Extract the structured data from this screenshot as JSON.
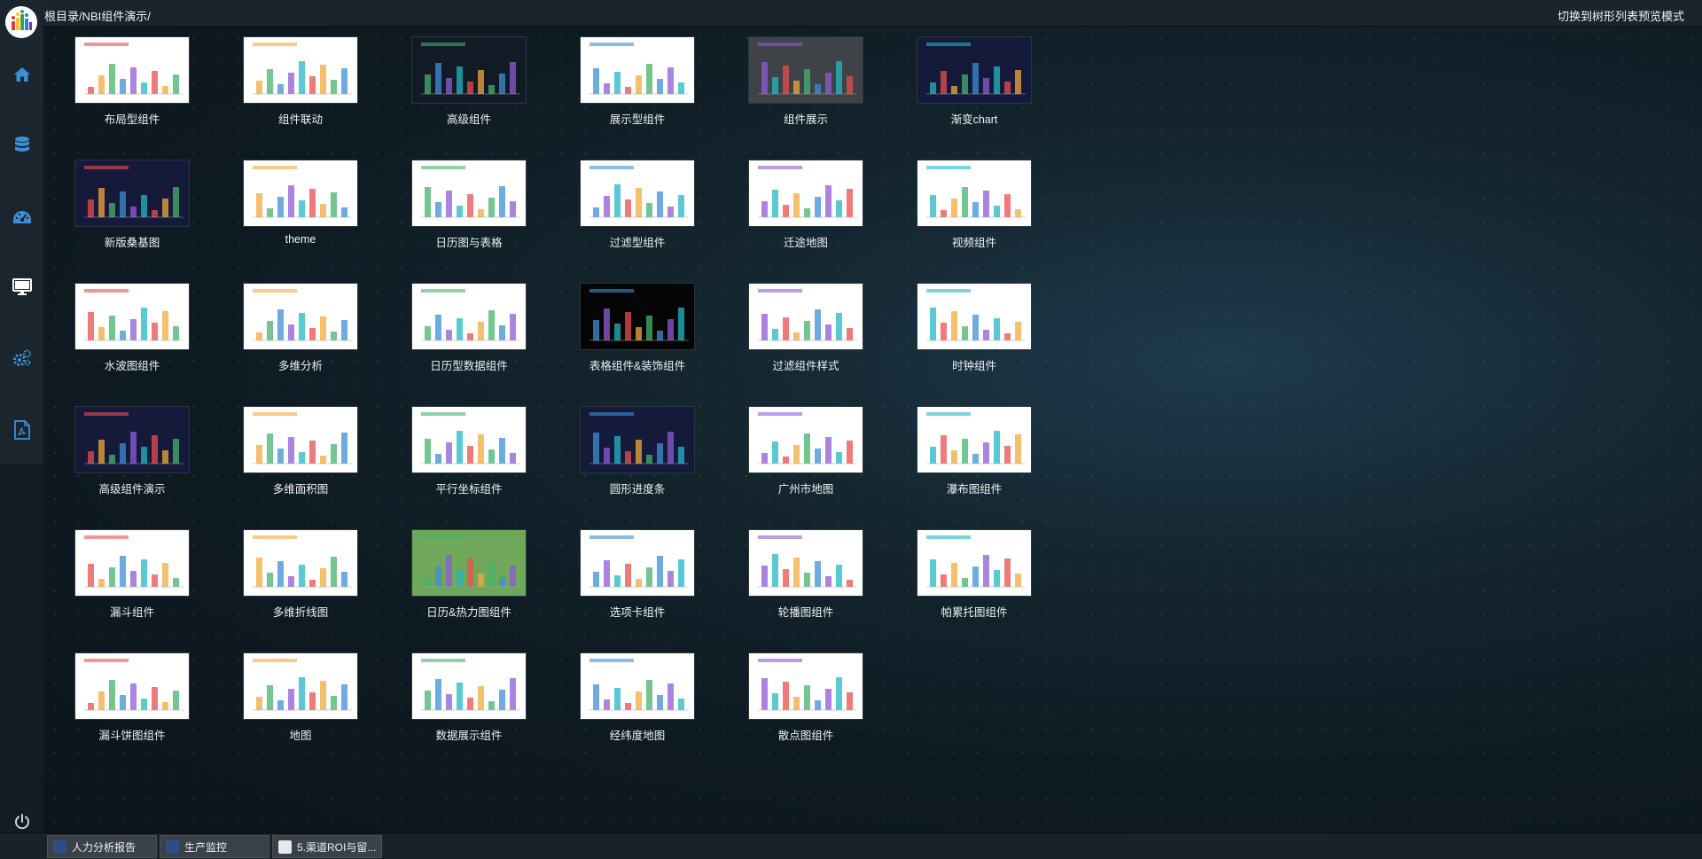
{
  "header": {
    "breadcrumb": "根目录/NBI组件演示/",
    "switch_mode": "切换到树形列表预览模式"
  },
  "sidebar": {
    "items": [
      {
        "icon": "home-icon"
      },
      {
        "icon": "database-icon"
      },
      {
        "icon": "dashboard-icon"
      },
      {
        "icon": "monitor-icon"
      },
      {
        "icon": "settings-icon"
      },
      {
        "icon": "pdf-icon"
      }
    ],
    "power_icon": "power-icon"
  },
  "components": [
    {
      "label": "布局型组件",
      "thumb": "light"
    },
    {
      "label": "组件联动",
      "thumb": "light"
    },
    {
      "label": "高级组件",
      "thumb": "dark"
    },
    {
      "label": "展示型组件",
      "thumb": "light"
    },
    {
      "label": "组件展示",
      "thumb": "gray"
    },
    {
      "label": "渐变chart",
      "thumb": "navy"
    },
    {
      "label": "新版桑基图",
      "thumb": "navy"
    },
    {
      "label": "theme",
      "thumb": "light"
    },
    {
      "label": "日历图与表格",
      "thumb": "light"
    },
    {
      "label": "过滤型组件",
      "thumb": "light"
    },
    {
      "label": "迁途地图",
      "thumb": "light"
    },
    {
      "label": "视频组件",
      "thumb": "light"
    },
    {
      "label": "水波图组件",
      "thumb": "light"
    },
    {
      "label": "多维分析",
      "thumb": "light"
    },
    {
      "label": "日历型数据组件",
      "thumb": "light"
    },
    {
      "label": "表格组件&装饰组件",
      "thumb": "black"
    },
    {
      "label": "过滤组件样式",
      "thumb": "light"
    },
    {
      "label": "时钟组件",
      "thumb": "light"
    },
    {
      "label": "高级组件演示",
      "thumb": "navy"
    },
    {
      "label": "多维面积图",
      "thumb": "light"
    },
    {
      "label": "平行坐标组件",
      "thumb": "light"
    },
    {
      "label": "圆形进度条",
      "thumb": "navy"
    },
    {
      "label": "广州市地图",
      "thumb": "light"
    },
    {
      "label": "瀑布图组件",
      "thumb": "light"
    },
    {
      "label": "漏斗组件",
      "thumb": "light"
    },
    {
      "label": "多维折线图",
      "thumb": "light"
    },
    {
      "label": "日历&热力图组件",
      "thumb": "green"
    },
    {
      "label": "选项卡组件",
      "thumb": "light"
    },
    {
      "label": "轮播图组件",
      "thumb": "light"
    },
    {
      "label": "帕累托图组件",
      "thumb": "light"
    },
    {
      "label": "漏斗饼图组件",
      "thumb": "light"
    },
    {
      "label": "地图",
      "thumb": "light"
    },
    {
      "label": "数据展示组件",
      "thumb": "light"
    },
    {
      "label": "经纬度地图",
      "thumb": "light"
    },
    {
      "label": "散点图组件",
      "thumb": "light"
    }
  ],
  "taskbar": {
    "tabs": [
      {
        "label": "人力分析报告",
        "icon": "report-icon"
      },
      {
        "label": "生产监控",
        "icon": "report-icon"
      },
      {
        "label": "5.渠道ROI与留...",
        "icon": "page-icon"
      }
    ]
  }
}
